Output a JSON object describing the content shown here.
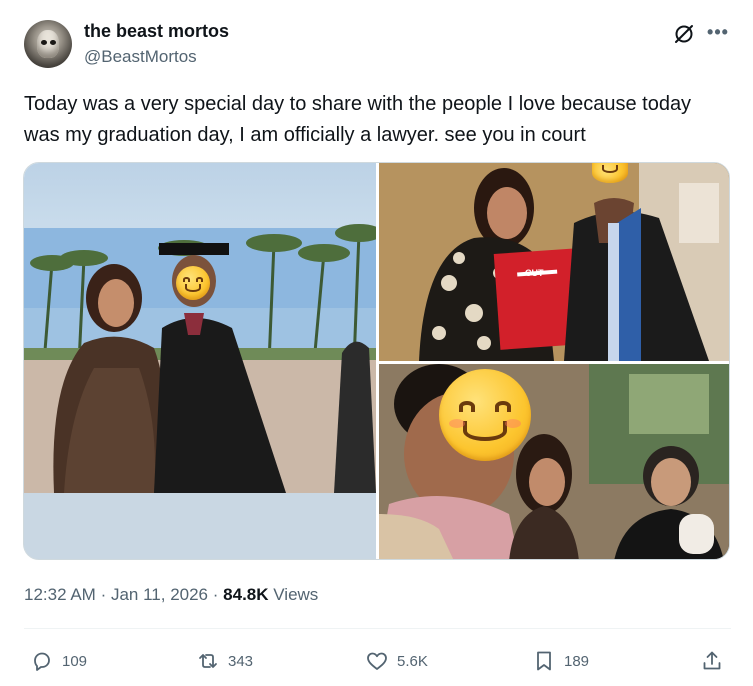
{
  "author": {
    "name": "the beast mortos",
    "handle": "@BeastMortos"
  },
  "tweet": {
    "text": "Today was a very special day to share with the people I love because today was my graduation day, I am officially a lawyer. see you in court"
  },
  "media": {
    "photos": [
      {
        "label": "graduation-photo-outdoor"
      },
      {
        "label": "graduation-photo-diploma"
      },
      {
        "label": "graduation-photo-family-selfie"
      }
    ],
    "diploma_text": "CUT"
  },
  "meta": {
    "time": "12:32 AM",
    "separator": "·",
    "date": "Jan 11, 2026",
    "views_count": "84.8K",
    "views_label": "Views"
  },
  "actions": {
    "replies": "109",
    "reposts": "343",
    "likes": "5.6K",
    "bookmarks": "189"
  },
  "icons": {
    "grok": "grok-icon",
    "more": "more-icon",
    "reply": "reply-icon",
    "repost": "repost-icon",
    "like": "heart-icon",
    "bookmark": "bookmark-icon",
    "share": "share-icon"
  },
  "colors": {
    "text_primary": "#0f1419",
    "text_secondary": "#536471",
    "border": "#cfd9de"
  }
}
